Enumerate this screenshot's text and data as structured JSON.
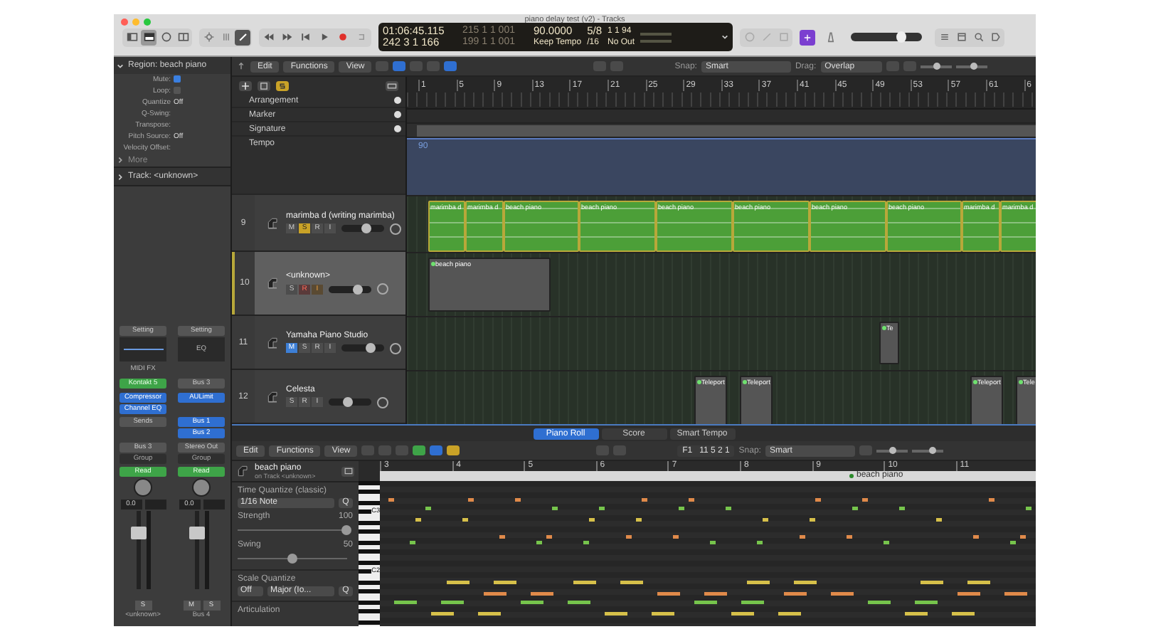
{
  "window": {
    "title": "piano delay test (v2) - Tracks"
  },
  "lcd": {
    "time": "01:06:45.115",
    "bars": "242 3 1 166",
    "locator_start": "215 1 1 001",
    "locator_end": "199 1 1 001",
    "tempo": "90.0000",
    "tempo_mode": "Keep Tempo",
    "signature": "5/8",
    "division": "/16",
    "position": "1 1 94",
    "midi_out": "No Out"
  },
  "master_volume": {
    "level": 0.72
  },
  "region_inspector": {
    "title": "Region: beach piano",
    "rows": [
      {
        "kind": "checkbox",
        "label": "Mute:",
        "checked": true
      },
      {
        "kind": "checkbox",
        "label": "Loop:",
        "checked": false
      },
      {
        "kind": "value",
        "label": "Quantize",
        "value": "Off"
      },
      {
        "kind": "value",
        "label": "Q-Swing:"
      },
      {
        "kind": "value",
        "label": "Transpose:"
      },
      {
        "kind": "value",
        "label": "Pitch Source:",
        "value": "Off"
      },
      {
        "kind": "value",
        "label": "Velocity Offset:"
      }
    ],
    "more": "More"
  },
  "track_inspector": {
    "title": "Track: <unknown>"
  },
  "channel_strips": [
    {
      "setting": "Setting",
      "midi_fx": "MIDI FX",
      "instrument": "Kontakt 5",
      "audio_fx": [
        "Compressor",
        "Channel EQ"
      ],
      "sends_label": "Sends",
      "output": "Bus 3",
      "group": "Group",
      "automation": "Read",
      "volume": "0.0",
      "fader": {
        "level": 0.72
      },
      "buttons": [
        "S"
      ],
      "name": "<unknown>"
    },
    {
      "setting": "Setting",
      "eq": "EQ",
      "input": "Bus 3",
      "audio_fx": [
        "AULimit"
      ],
      "sends": [
        "Bus 1",
        "Bus 2"
      ],
      "output": "Stereo Out",
      "group": "Group",
      "automation": "Read",
      "volume": "0.0",
      "fader": {
        "level": 0.72
      },
      "buttons": [
        "M",
        "S"
      ],
      "name": "Bus 4"
    }
  ],
  "tracks_toolbar": {
    "menus": [
      "Edit",
      "Functions",
      "View"
    ],
    "snap_label": "Snap:",
    "snap": "Smart",
    "drag_label": "Drag:",
    "drag": "Overlap"
  },
  "global_tracks": [
    "Arrangement",
    "Marker",
    "Signature",
    "Tempo"
  ],
  "ruler": [
    "1",
    "5",
    "9",
    "13",
    "17",
    "21",
    "25",
    "29",
    "33",
    "37",
    "41",
    "45",
    "49",
    "53",
    "57",
    "61",
    "6"
  ],
  "tempo_value": "90",
  "tracks": [
    {
      "number": "9",
      "name": "marimba d (writing marimba)",
      "selected": false,
      "volume": {
        "level": 0.6
      },
      "buttons": [
        {
          "kind": "mute",
          "label": "M",
          "on": false
        },
        {
          "kind": "solo",
          "label": "S",
          "on": true
        },
        {
          "kind": "record",
          "label": "R",
          "on": false
        },
        {
          "kind": "input",
          "label": "I",
          "on": false
        }
      ],
      "regions": [
        {
          "name": "marimba d",
          "color": "#4c9f38"
        },
        {
          "name": "marimba d",
          "color": "#4c9f38"
        },
        {
          "name": "beach piano",
          "color": "#4c9f38"
        },
        {
          "name": "beach piano",
          "color": "#4c9f38"
        },
        {
          "name": "beach piano",
          "color": "#4c9f38"
        },
        {
          "name": "beach piano",
          "color": "#4c9f38"
        },
        {
          "name": "beach piano",
          "color": "#4c9f38"
        },
        {
          "name": "beach piano",
          "color": "#4c9f38"
        },
        {
          "name": "marimba d",
          "color": "#4c9f38"
        },
        {
          "name": "marimba d",
          "color": "#4c9f38"
        }
      ]
    },
    {
      "number": "10",
      "name": "<unknown>",
      "selected": true,
      "volume": {
        "level": 0.7
      },
      "buttons": [
        {
          "kind": "solo",
          "label": "S",
          "on": false
        },
        {
          "kind": "record",
          "label": "R",
          "on": true
        },
        {
          "kind": "input",
          "label": "I",
          "on": true
        }
      ],
      "regions": [
        {
          "name": "beach piano",
          "color": "#555555"
        }
      ]
    },
    {
      "number": "11",
      "name": "Yamaha Piano Studio",
      "selected": false,
      "volume": {
        "level": 0.7
      },
      "buttons": [
        {
          "kind": "mute",
          "label": "M",
          "on": true
        },
        {
          "kind": "solo",
          "label": "S",
          "on": false
        },
        {
          "kind": "record",
          "label": "R",
          "on": false
        },
        {
          "kind": "input",
          "label": "I",
          "on": false
        }
      ],
      "regions": [
        {
          "name": "Te",
          "color": "#555555"
        }
      ]
    },
    {
      "number": "12",
      "name": "Celesta",
      "selected": false,
      "volume": {
        "level": 0.45
      },
      "buttons": [
        {
          "kind": "solo",
          "label": "S",
          "on": false
        },
        {
          "kind": "record",
          "label": "R",
          "on": false
        },
        {
          "kind": "input",
          "label": "I",
          "on": false
        }
      ],
      "regions": [
        {
          "name": "Teleport",
          "color": "#555555"
        },
        {
          "name": "Teleport",
          "color": "#555555"
        },
        {
          "name": "Teleport",
          "color": "#555555"
        },
        {
          "name": "Tele",
          "color": "#555555"
        }
      ]
    }
  ],
  "zoom_sliders": {
    "tracks": [
      {
        "level": 0.55
      },
      {
        "level": 0.6
      }
    ],
    "editor": [
      {
        "level": 0.55
      },
      {
        "level": 0.7
      }
    ]
  },
  "editor": {
    "tabs": [
      {
        "label": "Piano Roll",
        "selected": true
      },
      {
        "label": "Score",
        "selected": false
      },
      {
        "label": "Smart Tempo",
        "selected": false
      }
    ],
    "menus": [
      "Edit",
      "Functions",
      "View"
    ],
    "position": "F1   11 5 2 1",
    "snap_label": "Snap:",
    "snap": "Smart",
    "region": {
      "name": "beach piano",
      "track": "on Track <unknown>"
    },
    "time_quantize": {
      "title": "Time Quantize (classic)",
      "value": "1/16 Note",
      "button": "Q"
    },
    "strength": {
      "label": "Strength",
      "value": "100",
      "level": 1.0
    },
    "swing": {
      "label": "Swing",
      "value": "50",
      "level": 0.5
    },
    "scale_quantize": {
      "title": "Scale Quantize",
      "mode": "Off",
      "scale": "Major (Io...",
      "button": "Q"
    },
    "articulation": "Articulation",
    "ruler": [
      "3",
      "4",
      "5",
      "6",
      "7",
      "8",
      "9",
      "10",
      "11"
    ],
    "region_label": "beach piano",
    "keys": [
      "C3",
      "C2"
    ]
  }
}
